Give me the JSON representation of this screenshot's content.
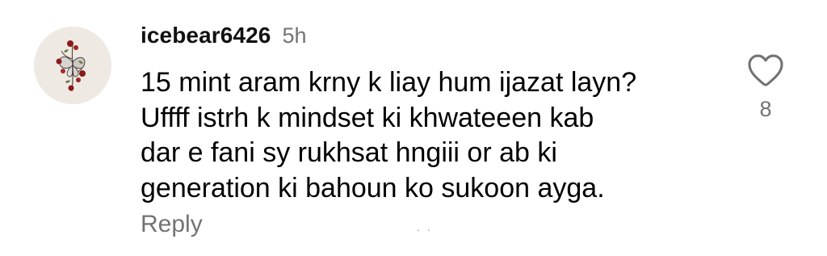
{
  "comment": {
    "username": "icebear6426",
    "timestamp": "5h",
    "text": "15 mint aram krny k liay hum ijazat layn?\nUffff istrh k mindset ki khwateeen kab\ndar e fani sy rukhsat hngiii or ab ki\ngeneration ki  bahoun ko sukoon ayga.",
    "reply_label": "Reply",
    "like_count": "8",
    "faint_mark": "· ·",
    "avatar_icon": "butterfly-roses-avatar",
    "like_icon": "heart-outline-icon"
  },
  "colors": {
    "primary_text": "#000000",
    "secondary_text": "#737373",
    "avatar_background": "#efe9e4",
    "rose": "#8b1a1a"
  }
}
